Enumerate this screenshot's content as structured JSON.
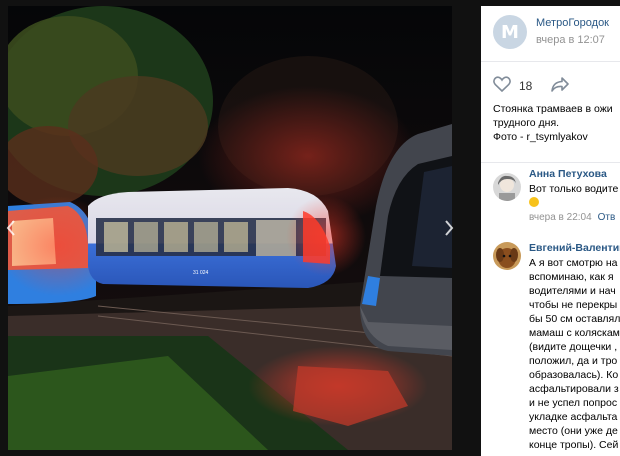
{
  "post": {
    "author": "МетроГородок",
    "time": "вчера в 12:07",
    "likes": "18",
    "text_lines": [
      "Стоянка трамваев в ожи",
      "трудного дня.",
      "Фото - r_tsymlyakov"
    ],
    "avatar_letter": "M"
  },
  "comments": [
    {
      "name": "Анна Петухова",
      "text_lines": [
        "Вот только водите"
      ],
      "time": "вчера в 22:04",
      "reply": "Отв"
    },
    {
      "name": "Евгений-Валентино",
      "text_lines": [
        "А я вот смотрю на",
        "вспоминаю, как я",
        "водителями и нач",
        "чтобы не перекры",
        "бы 50 см оставлял",
        "мамаш с коляскам",
        "(видите дощечки ,",
        "положил, да и тро",
        "образовалась). Ко",
        "асфальтировали з",
        "и не успел попрос",
        "укладке асфальта",
        "место (они уже де",
        "конце тропы). Сей"
      ]
    }
  ],
  "photo": {
    "tram_number": "31 024"
  },
  "colors": {
    "link": "#2a5885",
    "meta": "#939393",
    "tram_blue": "#2f63c8",
    "tram_red": "#ff2a2a"
  },
  "icons": [
    "heart-icon",
    "share-icon",
    "chevron-left-icon",
    "chevron-right-icon",
    "emoji-icon"
  ]
}
